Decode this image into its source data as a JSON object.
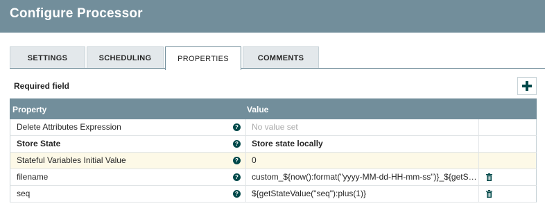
{
  "header": {
    "title": "Configure Processor"
  },
  "tabs": [
    {
      "label": "SETTINGS",
      "active": false
    },
    {
      "label": "SCHEDULING",
      "active": false
    },
    {
      "label": "PROPERTIES",
      "active": true
    },
    {
      "label": "COMMENTS",
      "active": false
    }
  ],
  "properties": {
    "required_label": "Required field",
    "add_icon": "plus-icon",
    "columns": {
      "property": "Property",
      "value": "Value"
    },
    "rows": [
      {
        "name": "Delete Attributes Expression",
        "value": "No value set",
        "bold": false,
        "empty": true,
        "deletable": false
      },
      {
        "name": "Store State",
        "value": "Store state locally",
        "bold": true,
        "empty": false,
        "deletable": false
      },
      {
        "name": "Stateful Variables Initial Value",
        "value": "0",
        "bold": false,
        "empty": false,
        "deletable": false
      },
      {
        "name": "filename",
        "value": "custom_${now():format(\"yyyy-MM-dd-HH-mm-ss\")}_${getStateValue(\"seq\")}",
        "bold": false,
        "empty": false,
        "deletable": true
      },
      {
        "name": "seq",
        "value": "${getStateValue(\"seq\"):plus(1)}",
        "bold": false,
        "empty": false,
        "deletable": true
      }
    ]
  },
  "colors": {
    "header": "#728e9b",
    "help": "#004849",
    "highlight": "#fdf9e7"
  }
}
